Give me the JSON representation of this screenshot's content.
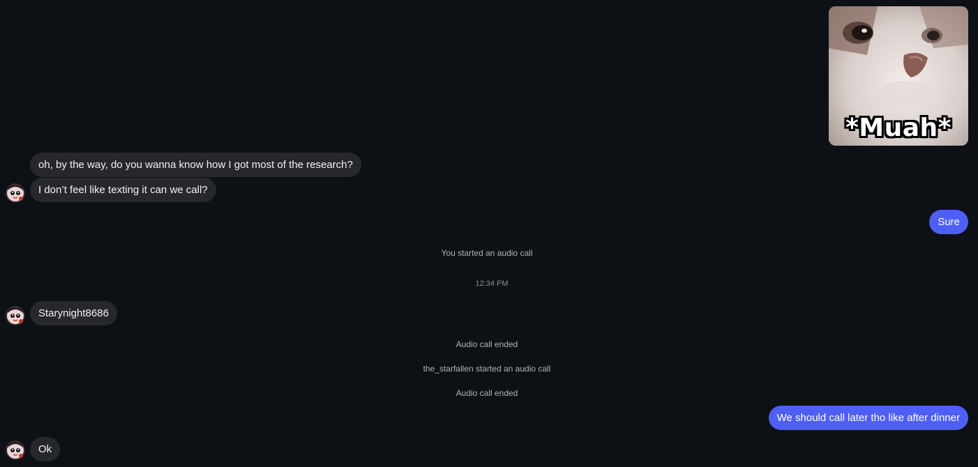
{
  "sticker": {
    "caption": "*Muah*",
    "icon": "cat-kiss-sticker"
  },
  "messages": {
    "incoming_1": "oh, by the way, do you wanna know how I got most of the research?",
    "incoming_2": "I don’t feel like texting it can we call?",
    "outgoing_1": "Sure",
    "incoming_3": "Starynight8686",
    "outgoing_2": "We should call later tho like after dinner",
    "incoming_4": "Ok"
  },
  "system": {
    "call_started_you": "You started an audio call",
    "timestamp": "12:34 PM",
    "call_ended_1": "Audio call ended",
    "call_started_other": "the_starfallen started an audio call",
    "call_ended_2": "Audio call ended"
  },
  "colors": {
    "background": "#0d1015",
    "incoming_bubble": "#26282d",
    "outgoing_bubble": "#4f5ff5"
  }
}
